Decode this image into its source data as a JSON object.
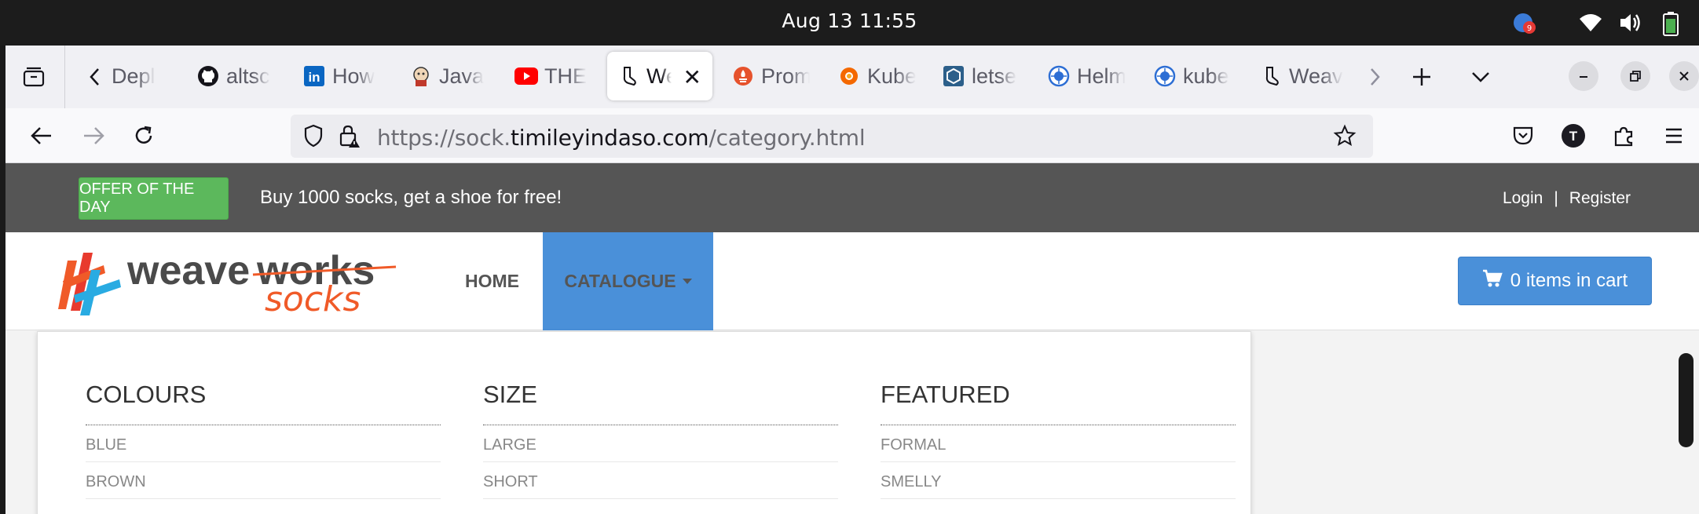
{
  "system": {
    "clock": "Aug 13  11:55",
    "notification_count": "9"
  },
  "browser": {
    "tabs": [
      {
        "title": "Depl",
        "icon": "deployment-icon"
      },
      {
        "title": "altsc",
        "icon": "github-icon"
      },
      {
        "title": "How",
        "icon": "linkedin-icon"
      },
      {
        "title": "Java",
        "icon": "jenkins-icon"
      },
      {
        "title": "THE",
        "icon": "youtube-icon"
      },
      {
        "title": "We",
        "icon": "sock-icon",
        "active": true
      },
      {
        "title": "Prom",
        "icon": "prometheus-icon"
      },
      {
        "title": "Kube",
        "icon": "grafana-icon"
      },
      {
        "title": "letse",
        "icon": "hexagon-icon"
      },
      {
        "title": "Helm",
        "icon": "helm-icon"
      },
      {
        "title": "kube",
        "icon": "helm-icon"
      },
      {
        "title": "Weav",
        "icon": "sock-icon"
      }
    ],
    "url": {
      "prefix": "https://sock.",
      "domain": "timileyindaso.com",
      "path": "/category.html"
    },
    "account_initial": "T"
  },
  "page": {
    "offer": {
      "badge": "OFFER OF THE DAY",
      "text": "Buy 1000 socks, get a shoe for free!"
    },
    "auth": {
      "login": "Login",
      "separator": "|",
      "register": "Register"
    },
    "logo": {
      "word1": "weave",
      "word2": "works",
      "word3": "socks"
    },
    "nav": {
      "home": "HOME",
      "catalogue": "CATALOGUE"
    },
    "cart": {
      "label": "0 items in cart"
    },
    "menu": {
      "colours": {
        "title": "COLOURS",
        "items": [
          "BLUE",
          "BROWN"
        ]
      },
      "size": {
        "title": "SIZE",
        "items": [
          "LARGE",
          "SHORT"
        ]
      },
      "featured": {
        "title": "FEATURED",
        "items": [
          "FORMAL",
          "SMELLY"
        ]
      }
    }
  },
  "colors": {
    "offer_green": "#5cb85c",
    "accent_blue": "#4a90d9",
    "offer_bar": "#555555",
    "logo_orange": "#f05a28",
    "logo_blue": "#29abe2"
  }
}
